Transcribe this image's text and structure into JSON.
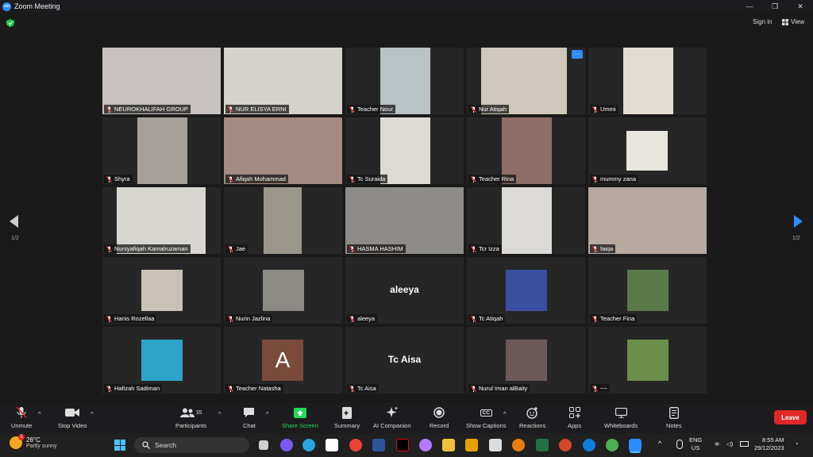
{
  "window": {
    "title": "Zoom Meeting",
    "minimize": "—",
    "maximize": "❐",
    "close": "✕"
  },
  "top": {
    "sign_in": "Sign in",
    "view": "View"
  },
  "pages": {
    "left": "1/2",
    "right": "1/2"
  },
  "tiles": [
    {
      "name": "NEUROKHALIFAH GROUP",
      "kind": "video",
      "active": true,
      "scene": "#c7c1bf"
    },
    {
      "name": "NUR ELISYA ERNI",
      "kind": "video",
      "scene": "#d6d3cc"
    },
    {
      "name": "Teacher Nour",
      "kind": "video",
      "scene": "#b9c2c4"
    },
    {
      "name": "Nur Atiqah",
      "kind": "video",
      "scene": "#cfc8bb",
      "more": "···"
    },
    {
      "name": "Ummi",
      "kind": "video",
      "scene": "#e2ddd3"
    },
    {
      "name": "Shyra",
      "kind": "video",
      "scene": "#a6a19a"
    },
    {
      "name": "Afiqah Mohammad",
      "kind": "video",
      "scene": "#a48a80"
    },
    {
      "name": "Tc Suraida",
      "kind": "video",
      "scene": "#dedbd5"
    },
    {
      "name": "Teacher Rina",
      "kind": "video",
      "scene": "#8e6e66"
    },
    {
      "name": "mummy zana",
      "kind": "video",
      "scene": "#e8e4de"
    },
    {
      "name": "Nursyafiqah Kamalruzaman",
      "kind": "video",
      "scene": "#d8d6d0"
    },
    {
      "name": "Jae",
      "kind": "video",
      "scene": "#9a968c"
    },
    {
      "name": "HASMA HASHIM",
      "kind": "video",
      "scene": "#8e8c88"
    },
    {
      "name": "Tcr Izza",
      "kind": "video",
      "scene": "#dcdad6"
    },
    {
      "name": "faiqa",
      "kind": "video",
      "scene": "#b6a9a2"
    },
    {
      "name": "Hanis Rozellaa",
      "kind": "photo",
      "scene": "#c9c1b5"
    },
    {
      "name": "Nurin Jazlina",
      "kind": "photo",
      "scene": "#8b8a84"
    },
    {
      "name": "aleeya",
      "kind": "text",
      "label": "aleeya"
    },
    {
      "name": "Tc Atiqah",
      "kind": "photo",
      "scene": "#3a4fa0"
    },
    {
      "name": "Teacher Fina",
      "kind": "photo",
      "scene": "#5b7a4a"
    },
    {
      "name": "Hafizah Sadiman",
      "kind": "photo",
      "scene": "#2fa3c8"
    },
    {
      "name": "Teacher Natasha",
      "kind": "avatar",
      "label": "A"
    },
    {
      "name": "Tc Aisa",
      "kind": "text",
      "label": "Tc Aisa"
    },
    {
      "name": "Nurul Iman alBaity",
      "kind": "photo",
      "scene": "#6c5a5a"
    },
    {
      "name": "~~",
      "kind": "photo",
      "scene": "#6d8d4a"
    }
  ],
  "toolbar": {
    "unmute": "Unmute",
    "stop_video": "Stop Video",
    "participants": "Participants",
    "participants_count": "35",
    "chat": "Chat",
    "share_screen": "Share Screen",
    "summary": "Summary",
    "ai_companion": "AI Companion",
    "record": "Record",
    "show_captions": "Show Captions",
    "cc": "CC",
    "reactions": "Reactions",
    "apps": "Apps",
    "whiteboards": "Whiteboards",
    "notes": "Notes",
    "leave": "Leave"
  },
  "taskbar": {
    "temp": "26°C",
    "weather": "Partly sunny",
    "weather_badge": "1",
    "search": "Search",
    "lang1": "ENG",
    "lang2": "US",
    "time": "8:55 AM",
    "date": "29/12/2023"
  },
  "colors": {
    "accent": "#2d8cff",
    "leave": "#e02828",
    "active_border": "#c8e87c",
    "share": "#23d959"
  }
}
